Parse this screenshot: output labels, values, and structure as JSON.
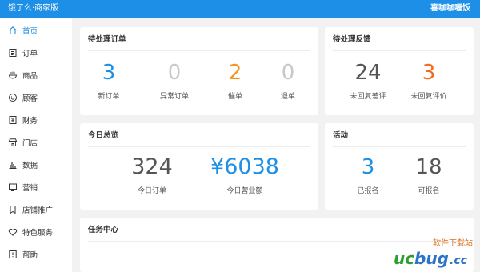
{
  "topbar": {
    "app_title": "饿了么·商家版",
    "shop_name": "喜咖咖喱饭"
  },
  "sidebar": {
    "items": [
      {
        "label": "首页",
        "icon": "home-icon",
        "active": true
      },
      {
        "label": "订单",
        "icon": "order-icon",
        "active": false
      },
      {
        "label": "商品",
        "icon": "food-icon",
        "active": false
      },
      {
        "label": "顾客",
        "icon": "smile-icon",
        "active": false
      },
      {
        "label": "财务",
        "icon": "finance-icon",
        "active": false
      },
      {
        "label": "门店",
        "icon": "store-icon",
        "active": false
      },
      {
        "label": "数据",
        "icon": "chart-icon",
        "active": false
      },
      {
        "label": "营销",
        "icon": "marketing-icon",
        "active": false
      },
      {
        "label": "店铺推广",
        "icon": "promote-icon",
        "active": false
      },
      {
        "label": "特色服务",
        "icon": "heart-icon",
        "active": false
      },
      {
        "label": "帮助",
        "icon": "help-icon",
        "active": false
      }
    ]
  },
  "pending_orders": {
    "title": "待处理订单",
    "stats": [
      {
        "value": "3",
        "label": "新订单",
        "color": "#1e8fe6"
      },
      {
        "value": "0",
        "label": "异常订单",
        "color": "#c8c8c8"
      },
      {
        "value": "2",
        "label": "催单",
        "color": "#f7941d"
      },
      {
        "value": "0",
        "label": "退单",
        "color": "#c8c8c8"
      }
    ]
  },
  "pending_feedback": {
    "title": "待处理反馈",
    "stats": [
      {
        "value": "24",
        "label": "未回复差评",
        "color": "#555555"
      },
      {
        "value": "3",
        "label": "未回复评价",
        "color": "#f26a1b"
      }
    ]
  },
  "today_overview": {
    "title": "今日总览",
    "stats": [
      {
        "value": "324",
        "label": "今日订单",
        "color": "#555555"
      },
      {
        "value": "¥6038",
        "label": "今日营业额",
        "color": "#1e8fe6"
      }
    ]
  },
  "activities": {
    "title": "活动",
    "stats": [
      {
        "value": "3",
        "label": "已报名",
        "color": "#1e8fe6"
      },
      {
        "value": "18",
        "label": "可报名",
        "color": "#555555"
      }
    ]
  },
  "task_center": {
    "title": "任务中心"
  },
  "watermark": {
    "cn": "软件下载站",
    "brand_uc": "uc",
    "brand_bug": "bug",
    "brand_cc": ".cc"
  },
  "colors": {
    "accent": "#1e8fe6",
    "warning": "#f7941d",
    "alert": "#f26a1b",
    "muted": "#c8c8c8"
  }
}
